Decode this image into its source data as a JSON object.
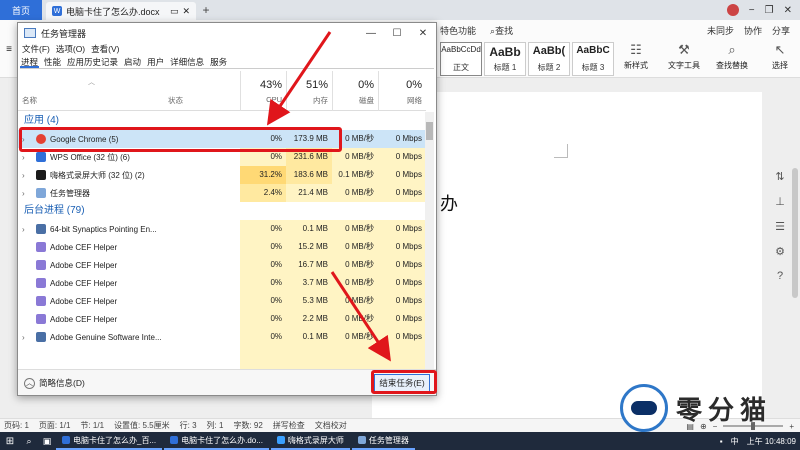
{
  "browser": {
    "home_tab": "首页",
    "doc_tab": "电脑卡住了怎么办.docx",
    "doc_tab_badge": "W",
    "new_tab": "+",
    "ctrls": [
      "−",
      "❐",
      "✕"
    ]
  },
  "ribbon": {
    "menu": [
      "特色功能",
      "查找"
    ],
    "right_actions": [
      "未同步",
      "协作",
      "分享"
    ],
    "styles": [
      {
        "sample": "AaBbCcDd",
        "label": "正文"
      },
      {
        "sample": "AaBb",
        "label": "标题 1"
      },
      {
        "sample": "AaBb(",
        "label": "标题 2"
      },
      {
        "sample": "AaBbC",
        "label": "标题 3"
      }
    ],
    "tools": [
      "新样式",
      "文字工具",
      "查找替换",
      "选择"
    ]
  },
  "document": {
    "visible_text": "办"
  },
  "statusbar": {
    "items": [
      "页码: 1",
      "页面: 1/1",
      "节: 1/1",
      "设置值: 5.5厘米",
      "行: 3",
      "列: 1",
      "字数: 92",
      "拼写检查",
      "文档校对"
    ],
    "zoom_minus": "−",
    "zoom_plus": "+"
  },
  "taskbar": {
    "apps": [
      {
        "label": "电脑卡住了怎么办_百...",
        "color": "#2f6fd8"
      },
      {
        "label": "电脑卡住了怎么办.do...",
        "color": "#2f6fd8"
      },
      {
        "label": "嗨格式录屏大师",
        "color": "#3aa0ff"
      },
      {
        "label": "任务管理器",
        "color": "#7fa7d9"
      }
    ],
    "ime": "中",
    "time": "上午 10:48:09"
  },
  "task_manager": {
    "title": "任务管理器",
    "menu": [
      "文件(F)",
      "选项(O)",
      "查看(V)"
    ],
    "tabs": [
      "进程",
      "性能",
      "应用历史记录",
      "启动",
      "用户",
      "详细信息",
      "服务"
    ],
    "active_tab": "进程",
    "columns": {
      "name": "名称",
      "status": "状态",
      "cpu": {
        "pct": "43%",
        "label": "CPU"
      },
      "mem": {
        "pct": "51%",
        "label": "内存"
      },
      "disk": {
        "pct": "0%",
        "label": "磁盘"
      },
      "net": {
        "pct": "0%",
        "label": "网络"
      }
    },
    "groups": {
      "apps": "应用 (4)",
      "background": "后台进程 (79)"
    },
    "apps": [
      {
        "name": "Google Chrome (5)",
        "cpu": "0%",
        "mem": "173.9 MB",
        "disk": "0 MB/秒",
        "net": "0 Mbps",
        "color": "#e44134",
        "selected": true
      },
      {
        "name": "WPS Office (32 位) (6)",
        "cpu": "0%",
        "mem": "231.6 MB",
        "disk": "0 MB/秒",
        "net": "0 Mbps",
        "color": "#2f6fd8"
      },
      {
        "name": "嗨格式录屏大师 (32 位) (2)",
        "cpu": "31.2%",
        "mem": "183.6 MB",
        "disk": "0.1 MB/秒",
        "net": "0 Mbps",
        "color": "#1b1b1b"
      },
      {
        "name": "任务管理器",
        "cpu": "2.4%",
        "mem": "21.4 MB",
        "disk": "0 MB/秒",
        "net": "0 Mbps",
        "color": "#7fa7d9"
      }
    ],
    "background": [
      {
        "name": "64-bit Synaptics Pointing En...",
        "cpu": "0%",
        "mem": "0.1 MB",
        "disk": "0 MB/秒",
        "net": "0 Mbps",
        "color": "#4a6fa5"
      },
      {
        "name": "Adobe CEF Helper",
        "cpu": "0%",
        "mem": "15.2 MB",
        "disk": "0 MB/秒",
        "net": "0 Mbps",
        "color": "#8a79d6"
      },
      {
        "name": "Adobe CEF Helper",
        "cpu": "0%",
        "mem": "16.7 MB",
        "disk": "0 MB/秒",
        "net": "0 Mbps",
        "color": "#8a79d6"
      },
      {
        "name": "Adobe CEF Helper",
        "cpu": "0%",
        "mem": "3.7 MB",
        "disk": "0 MB/秒",
        "net": "0 Mbps",
        "color": "#8a79d6"
      },
      {
        "name": "Adobe CEF Helper",
        "cpu": "0%",
        "mem": "5.3 MB",
        "disk": "0 MB/秒",
        "net": "0 Mbps",
        "color": "#8a79d6"
      },
      {
        "name": "Adobe CEF Helper",
        "cpu": "0%",
        "mem": "2.2 MB",
        "disk": "0 MB/秒",
        "net": "0 Mbps",
        "color": "#8a79d6"
      },
      {
        "name": "Adobe Genuine Software Inte...",
        "cpu": "0%",
        "mem": "0.1 MB",
        "disk": "0 MB/秒",
        "net": "0 Mbps",
        "color": "#4a6fa5"
      }
    ],
    "fewer_details": "简略信息(D)",
    "end_task": "结束任务(E)"
  },
  "watermark": {
    "text": "零分猫"
  },
  "colors": {
    "accent": "#2f6fd8",
    "annotation": "#e0161b",
    "cpu_high": "#ffd975"
  }
}
